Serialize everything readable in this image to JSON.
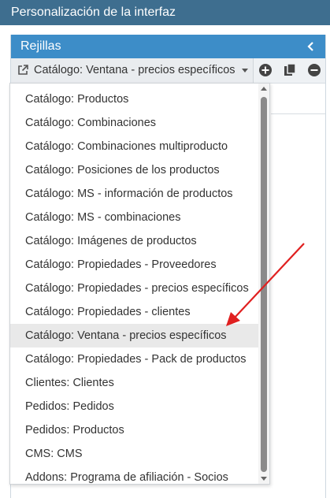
{
  "top_bar": {
    "title": "Personalización de la interfaz"
  },
  "panel": {
    "title": "Rejillas",
    "collapse_icon": "chevron-left-icon"
  },
  "grid_selector": {
    "selected": "Catálogo: Ventana - precios específicos",
    "icon": "external-link-icon"
  },
  "toolbar_icons": [
    "add-circle-icon",
    "copy-icon",
    "remove-circle-icon"
  ],
  "dropdown": {
    "items": [
      "Catálogo: Productos",
      "Catálogo: Combinaciones",
      "Catálogo: Combinaciones multiproducto",
      "Catálogo: Posiciones de los productos",
      "Catálogo: MS - información de productos",
      "Catálogo: MS - combinaciones",
      "Catálogo: Imágenes de productos",
      "Catálogo: Propiedades - Proveedores",
      "Catálogo: Propiedades - precios específicos",
      "Catálogo: Propiedades - clientes",
      "Catálogo: Ventana - precios específicos",
      "Catálogo: Propiedades - Pack de productos",
      "Clientes: Clientes",
      "Pedidos: Pedidos",
      "Pedidos: Productos",
      "CMS: CMS",
      "Addons: Programa de afiliación - Socios"
    ],
    "highlighted_index": 10
  },
  "colors": {
    "top_bar": "#3e6e8f",
    "panel_header": "#3d8dc8",
    "annotation_arrow": "#e02020",
    "highlight_row": "#e9e9e9"
  }
}
